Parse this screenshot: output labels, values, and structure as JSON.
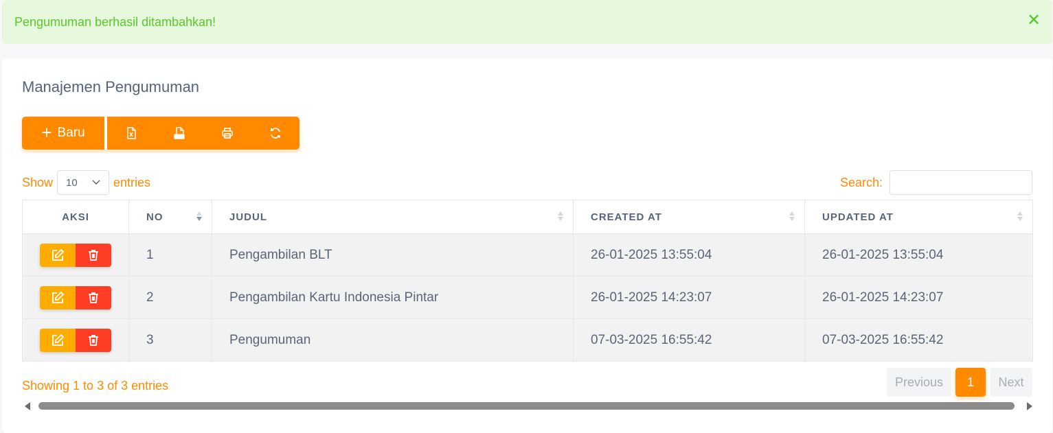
{
  "alert": {
    "message": "Pengumuman berhasil ditambahkan!",
    "close_symbol": "✕",
    "bg_color": "#e6f9dd",
    "text_color": "#59c92a"
  },
  "card": {
    "title": "Manajemen Pengumuman"
  },
  "toolbar": {
    "new_label": "Baru",
    "plus_symbol": "+",
    "icons": [
      "excel-export-icon",
      "csv-export-icon",
      "print-icon",
      "refresh-icon"
    ],
    "accent_color": "#ff8a00"
  },
  "length": {
    "show_label": "Show",
    "value": "10",
    "entries_label": "entries"
  },
  "search": {
    "label": "Search:",
    "value": ""
  },
  "table": {
    "headers": [
      "AKSI",
      "NO",
      "JUDUL",
      "CREATED AT",
      "UPDATED AT"
    ],
    "rows": [
      {
        "no": "1",
        "judul": "Pengambilan BLT",
        "created_at": "26-01-2025 13:55:04",
        "updated_at": "26-01-2025 13:55:04"
      },
      {
        "no": "2",
        "judul": "Pengambilan Kartu Indonesia Pintar",
        "created_at": "26-01-2025 14:23:07",
        "updated_at": "26-01-2025 14:23:07"
      },
      {
        "no": "3",
        "judul": "Pengumuman",
        "created_at": "07-03-2025 16:55:42",
        "updated_at": "07-03-2025 16:55:42"
      }
    ],
    "edit_color": "#ffac00",
    "delete_color": "#ff3d24"
  },
  "footer": {
    "info": "Showing 1 to 3 of 3 entries",
    "previous_label": "Previous",
    "current_page": "1",
    "next_label": "Next"
  }
}
